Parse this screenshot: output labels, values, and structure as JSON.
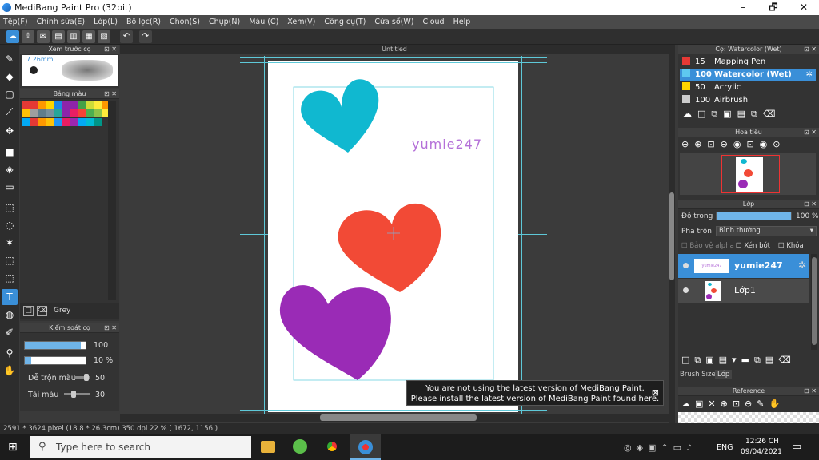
{
  "window": {
    "title": "MediBang Paint Pro (32bit)",
    "minimize": "–",
    "maximize": "🗗",
    "close": "✕"
  },
  "menu": [
    "Tệp(F)",
    "Chỉnh sửa(E)",
    "Lớp(L)",
    "Bộ lọc(R)",
    "Chọn(S)",
    "Chụp(N)",
    "Màu (C)",
    "Xem(V)",
    "Công cụ(T)",
    "Cửa sổ(W)",
    "Cloud",
    "Help"
  ],
  "panels": {
    "brush_preview": {
      "title": "Xem trước cọ",
      "size": "7.26mm"
    },
    "palette": {
      "title": "Bảng màu",
      "color_name": "Grey",
      "colors": [
        "#e53935",
        "#e53935",
        "#ff9800",
        "#ffd600",
        "#1e88e5",
        "#8e24aa",
        "#8e24aa",
        "#43a047",
        "#cddc39",
        "#ffeb3b",
        "#ff9800",
        "#ffc107",
        "#9e9e9e",
        "#607d8b",
        "#78909c",
        "#26a69a",
        "#8e24aa",
        "#e91e63",
        "#f44336",
        "#4caf50",
        "#8bc34a",
        "#ffeb3b",
        "#03a9f4",
        "#e53935",
        "#ff9800",
        "#ffc107",
        "#2196f3",
        "#e91e63",
        "#9c27b0",
        "#03a9f4",
        "#00bcd4",
        "#009688"
      ]
    },
    "brush_control": {
      "title": "Kiểm soát cọ",
      "size_value": "100",
      "opacity_value": "10 %",
      "blend_label": "Dễ trộn màu",
      "blend_value": "50",
      "refill_label": "Tải màu",
      "refill_value": "30"
    },
    "brushes": {
      "title": "Cọ: Watercolor (Wet)",
      "items": [
        {
          "size": "15",
          "name": "Mapping Pen",
          "color": "#e53935"
        },
        {
          "size": "100",
          "name": "Watercolor (Wet)",
          "color": "#5ec8f0"
        },
        {
          "size": "50",
          "name": "Acrylic",
          "color": "#ffd600"
        },
        {
          "size": "100",
          "name": "Airbrush",
          "color": "#cccccc"
        }
      ]
    },
    "navigator": {
      "title": "Hoa tiêu"
    },
    "layers": {
      "title": "Lớp",
      "opacity_label": "Độ trong",
      "opacity_value": "100 %",
      "blend_label": "Pha trộn",
      "blend_value": "Bình thường",
      "protect_alpha": "Bảo vệ alpha",
      "clipping": "Xén bớt",
      "lock": "Khóa",
      "items": [
        {
          "name": "yumie247",
          "thumb": "yumie247"
        },
        {
          "name": "Lớp1"
        }
      ],
      "tabs": [
        "Brush Size",
        "Lớp"
      ]
    },
    "reference": {
      "title": "Reference"
    }
  },
  "canvas": {
    "tab": "Untitled",
    "watermark_text": "yumie247",
    "hearts": [
      {
        "color": "#10b8d0"
      },
      {
        "color": "#f24a36"
      },
      {
        "color": "#9a2bb6"
      }
    ]
  },
  "status": "2591 * 3624 pixel  (18.8 * 26.3cm)  350 dpi  22 %  ( 1672, 1156 )",
  "notice": {
    "line1": "You are not using the latest version of MediBang Paint.",
    "line2": "Please install the latest version of MediBang Paint found here.",
    "close": "⊠"
  },
  "taskbar": {
    "search_placeholder": "Type here to search",
    "lang": "ENG",
    "time": "12:26 CH",
    "date": "09/04/2021"
  }
}
